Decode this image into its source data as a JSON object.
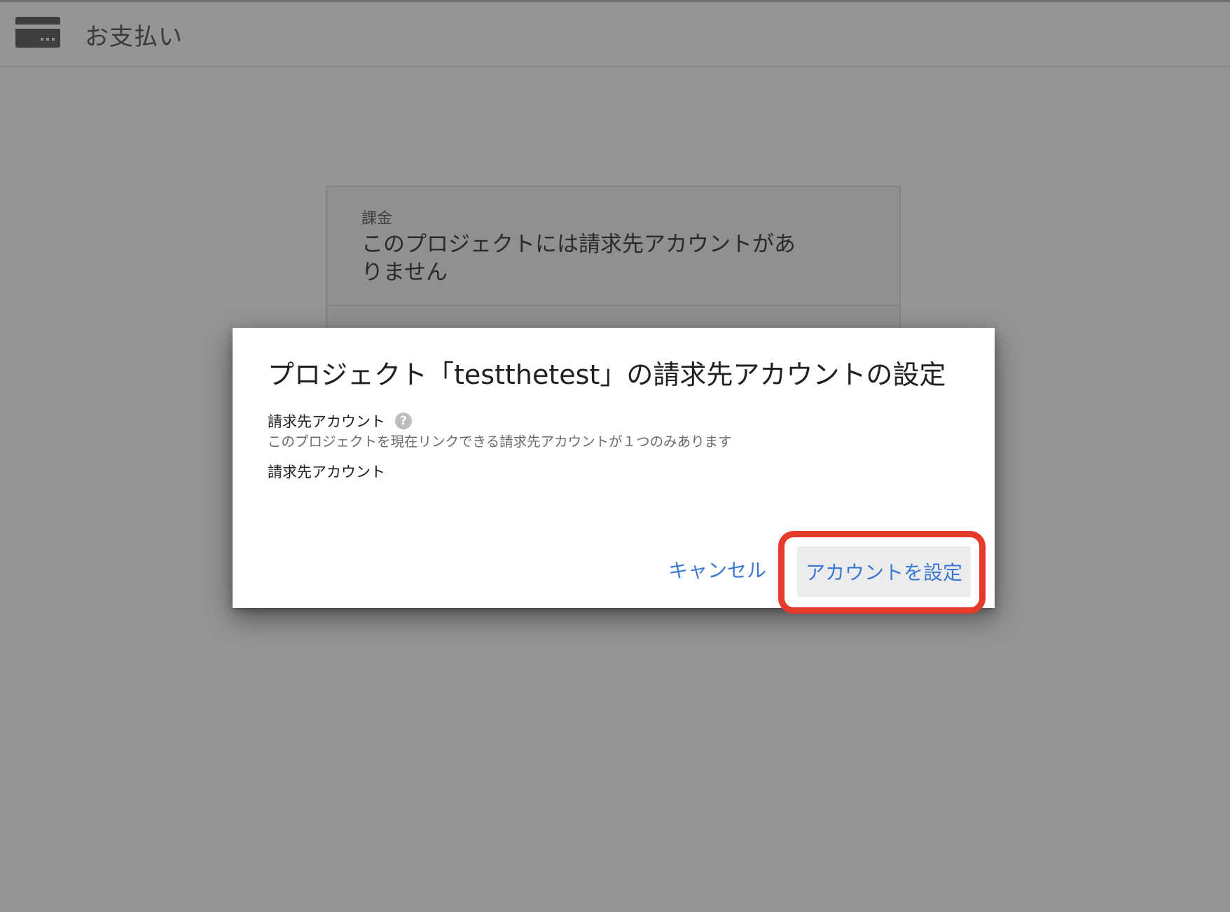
{
  "header": {
    "icon": "credit-card-icon",
    "title": "お支払い"
  },
  "background_card": {
    "label": "課金",
    "title": "このプロジェクトには請求先アカウントがありません"
  },
  "dialog": {
    "title": "プロジェクト「testthetest」の請求先アカウントの設定",
    "field_label": "請求先アカウント",
    "help_icon": "question-mark-icon",
    "help_glyph": "?",
    "hint": "このプロジェクトを現在リンクできる請求先アカウントが１つのみあります",
    "field_value": "請求先アカウント",
    "cancel_label": "キャンセル",
    "confirm_label": "アカウントを設定"
  },
  "colors": {
    "overlay_background": "#959595",
    "link_blue": "#3b78d6",
    "highlight_red": "#e63a2a",
    "confirm_button_bg": "#ececec"
  }
}
